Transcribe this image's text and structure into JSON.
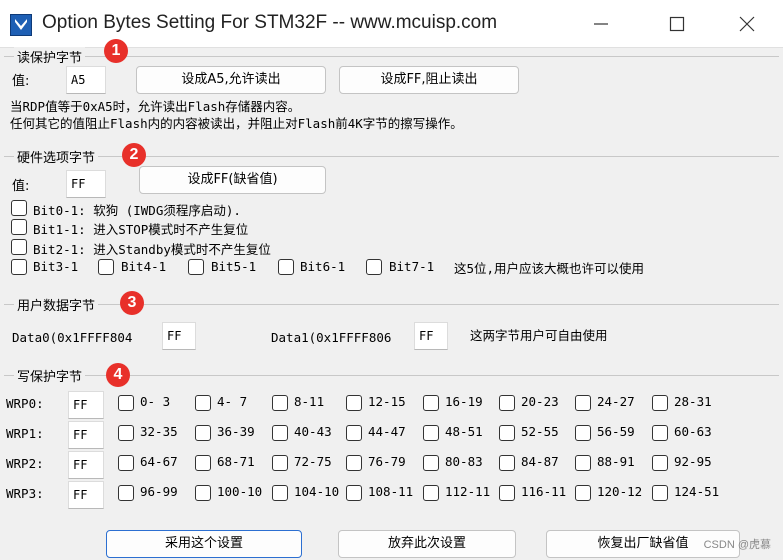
{
  "window": {
    "title": "Option Bytes Setting For STM32F -- www.mcuisp.com"
  },
  "read_protect": {
    "title": "读保护字节",
    "badge": "1",
    "value_label": "值:",
    "value": "A5",
    "btn_allow": "设成A5,允许读出",
    "btn_block": "设成FF,阻止读出",
    "desc1": "当RDP值等于0xA5时，允许读出Flash存储器内容。",
    "desc2": "任何其它的值阻止Flash内的内容被读出，并阻止对Flash前4K字节的擦写操作。"
  },
  "hw_options": {
    "title": "硬件选项字节",
    "badge": "2",
    "value_label": "值:",
    "value": "FF",
    "btn_default": "设成FF(缺省值)",
    "bit0": "Bit0-1: 软狗 (IWDG须程序启动).",
    "bit1": "Bit1-1: 进入STOP模式时不产生复位",
    "bit2": "Bit2-1: 进入Standby模式时不产生复位",
    "bit3": "Bit3-1",
    "bit4": "Bit4-1",
    "bit5": "Bit5-1",
    "bit6": "Bit6-1",
    "bit7": "Bit7-1",
    "bits_note": "这5位,用户应该大概也许可以使用"
  },
  "user_data": {
    "title": "用户数据字节",
    "badge": "3",
    "data0_label": "Data0(0x1FFFF804",
    "data0_value": "FF",
    "data1_label": "Data1(0x1FFFF806",
    "data1_value": "FF",
    "note": "这两字节用户可自由使用"
  },
  "write_protect": {
    "title": "写保护字节",
    "badge": "4",
    "rows": [
      {
        "label": "WRP0:",
        "value": "FF",
        "pages": [
          "0- 3",
          "4- 7",
          "8-11",
          "12-15",
          "16-19",
          "20-23",
          "24-27",
          "28-31"
        ]
      },
      {
        "label": "WRP1:",
        "value": "FF",
        "pages": [
          "32-35",
          "36-39",
          "40-43",
          "44-47",
          "48-51",
          "52-55",
          "56-59",
          "60-63"
        ]
      },
      {
        "label": "WRP2:",
        "value": "FF",
        "pages": [
          "64-67",
          "68-71",
          "72-75",
          "76-79",
          "80-83",
          "84-87",
          "88-91",
          "92-95"
        ]
      },
      {
        "label": "WRP3:",
        "value": "FF",
        "pages": [
          "96-99",
          "100-10",
          "104-10",
          "108-11",
          "112-11",
          "116-11",
          "120-12",
          "124-51"
        ]
      }
    ]
  },
  "footer": {
    "apply": "采用这个设置",
    "discard": "放弃此次设置",
    "restore": "恢复出厂缺省值"
  },
  "watermark": "CSDN @虎慕",
  "colors": {
    "badge": "#e8302a",
    "primary_border": "#2c6fd1"
  }
}
